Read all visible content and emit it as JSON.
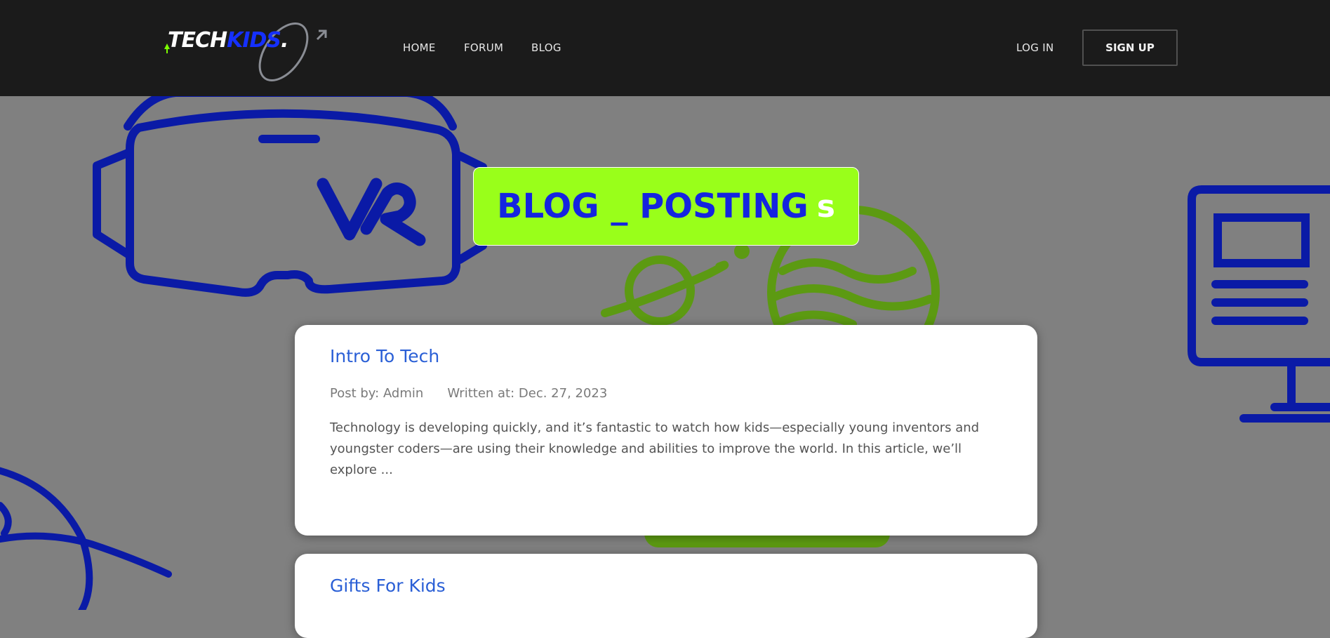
{
  "brand": {
    "logo_part1": "TECH",
    "logo_part2": "KIDS",
    "logo_dot": "."
  },
  "nav": {
    "home": "HOME",
    "forum": "FORUM",
    "blog": "BLOG",
    "login": "LOG IN",
    "signup": "SIGN UP"
  },
  "hero": {
    "title_main": "BLOG _ POSTING",
    "title_suffix": "s"
  },
  "posts": [
    {
      "title": "Intro To Tech",
      "author": "Post by: Admin",
      "date": "Written at: Dec. 27, 2023",
      "excerpt": "Technology is developing quickly, and it’s fantastic to watch how kids—especially young inventors and youngster coders—are using their knowledge and abilities to improve the world. In this article, we’ll explore ..."
    },
    {
      "title": "Gifts For Kids"
    }
  ],
  "colors": {
    "navbar": "#1b1b1b",
    "page_background": "#808080",
    "badge": "#99ff1a",
    "badge_text": "#1424e0",
    "post_title": "#2a5fd6",
    "illustration_blue": "#0a1aa6",
    "illustration_green": "#5c9a12"
  },
  "icons": {
    "vr_headset": "vr-headset-illustration",
    "planets": "planets-illustration",
    "monitor": "computer-monitor-illustration",
    "scribble": "scribble-illustration"
  }
}
